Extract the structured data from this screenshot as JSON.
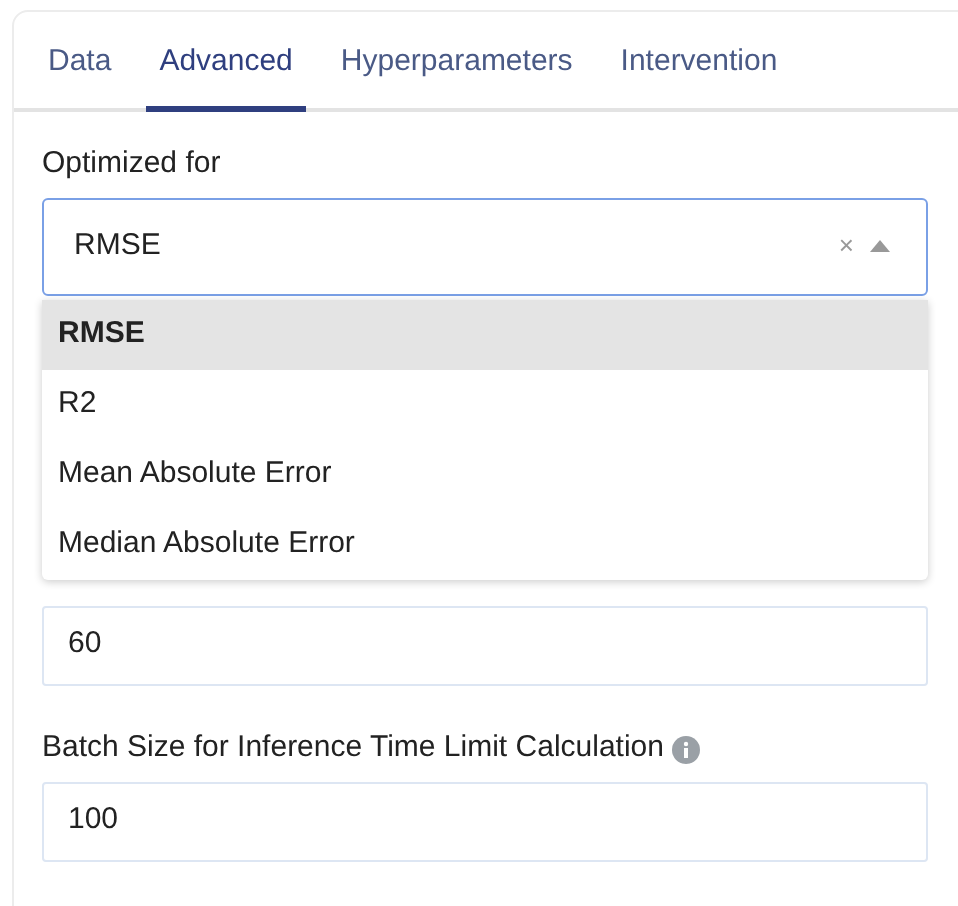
{
  "tabs": [
    {
      "label": "Data",
      "selected": false
    },
    {
      "label": "Advanced",
      "selected": true
    },
    {
      "label": "Hyperparameters",
      "selected": false
    },
    {
      "label": "Intervention",
      "selected": false
    }
  ],
  "optimized_for": {
    "label": "Optimized for",
    "value": "RMSE",
    "clear": "×",
    "expanded": true,
    "options": [
      {
        "label": "RMSE",
        "selected": true
      },
      {
        "label": "R2",
        "selected": false
      },
      {
        "label": "Mean Absolute Error",
        "selected": false
      },
      {
        "label": "Median Absolute Error",
        "selected": false
      }
    ]
  },
  "fields": [
    {
      "value": "60"
    },
    {
      "label": "Batch Size for Inference Time Limit Calculation",
      "info": true,
      "value": "100"
    }
  ]
}
